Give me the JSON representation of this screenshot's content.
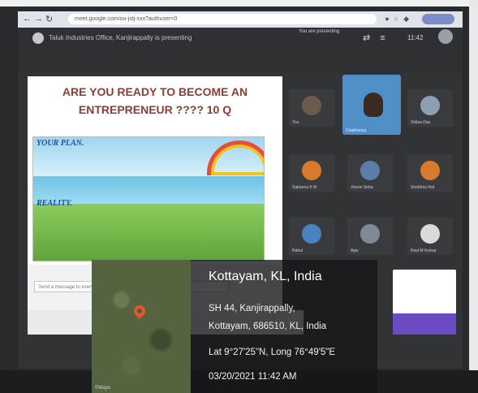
{
  "browser": {
    "url": "meet.google.com/ou-jstj-xxx?authuser=0",
    "clock": "11:42"
  },
  "meet": {
    "window_title": "Taluk Industries Office, Kanjirappally is presenting",
    "present_label": "You are presenting"
  },
  "slide": {
    "title_line1": "ARE YOU READY TO BECOME AN",
    "title_line2": "ENTREPRENEUR ????   10 Q",
    "plan_label": "YOUR PLAN.",
    "reality_label": "REALITY.",
    "footer_placeholder": "Send a message to everyone"
  },
  "participants": [
    {
      "name": "You"
    },
    {
      "name": "Chaithanya"
    },
    {
      "name": "Shilpa Das"
    },
    {
      "name": "Sabeena K M"
    },
    {
      "name": "Jinson Seba"
    },
    {
      "name": "Shobhna Rat"
    },
    {
      "name": "Rahul"
    },
    {
      "name": "Ajay"
    },
    {
      "name": "Ravi M Kumar"
    }
  ],
  "geotag": {
    "city": "Kottayam, KL, India",
    "address_line1": "SH 44, Kanjirappally,",
    "address_line2": "Kottayam, 686510, KL, India",
    "lat_long": "Lat 9°27'25\"N, Long 76°49'5\"E",
    "datetime": "03/20/2021 11:42 AM",
    "map_watermark": "©Maps"
  },
  "colors": {
    "slide_title": "#8a3d33",
    "geo_panel_bg": "#14161a",
    "pin": "#e4562d"
  }
}
